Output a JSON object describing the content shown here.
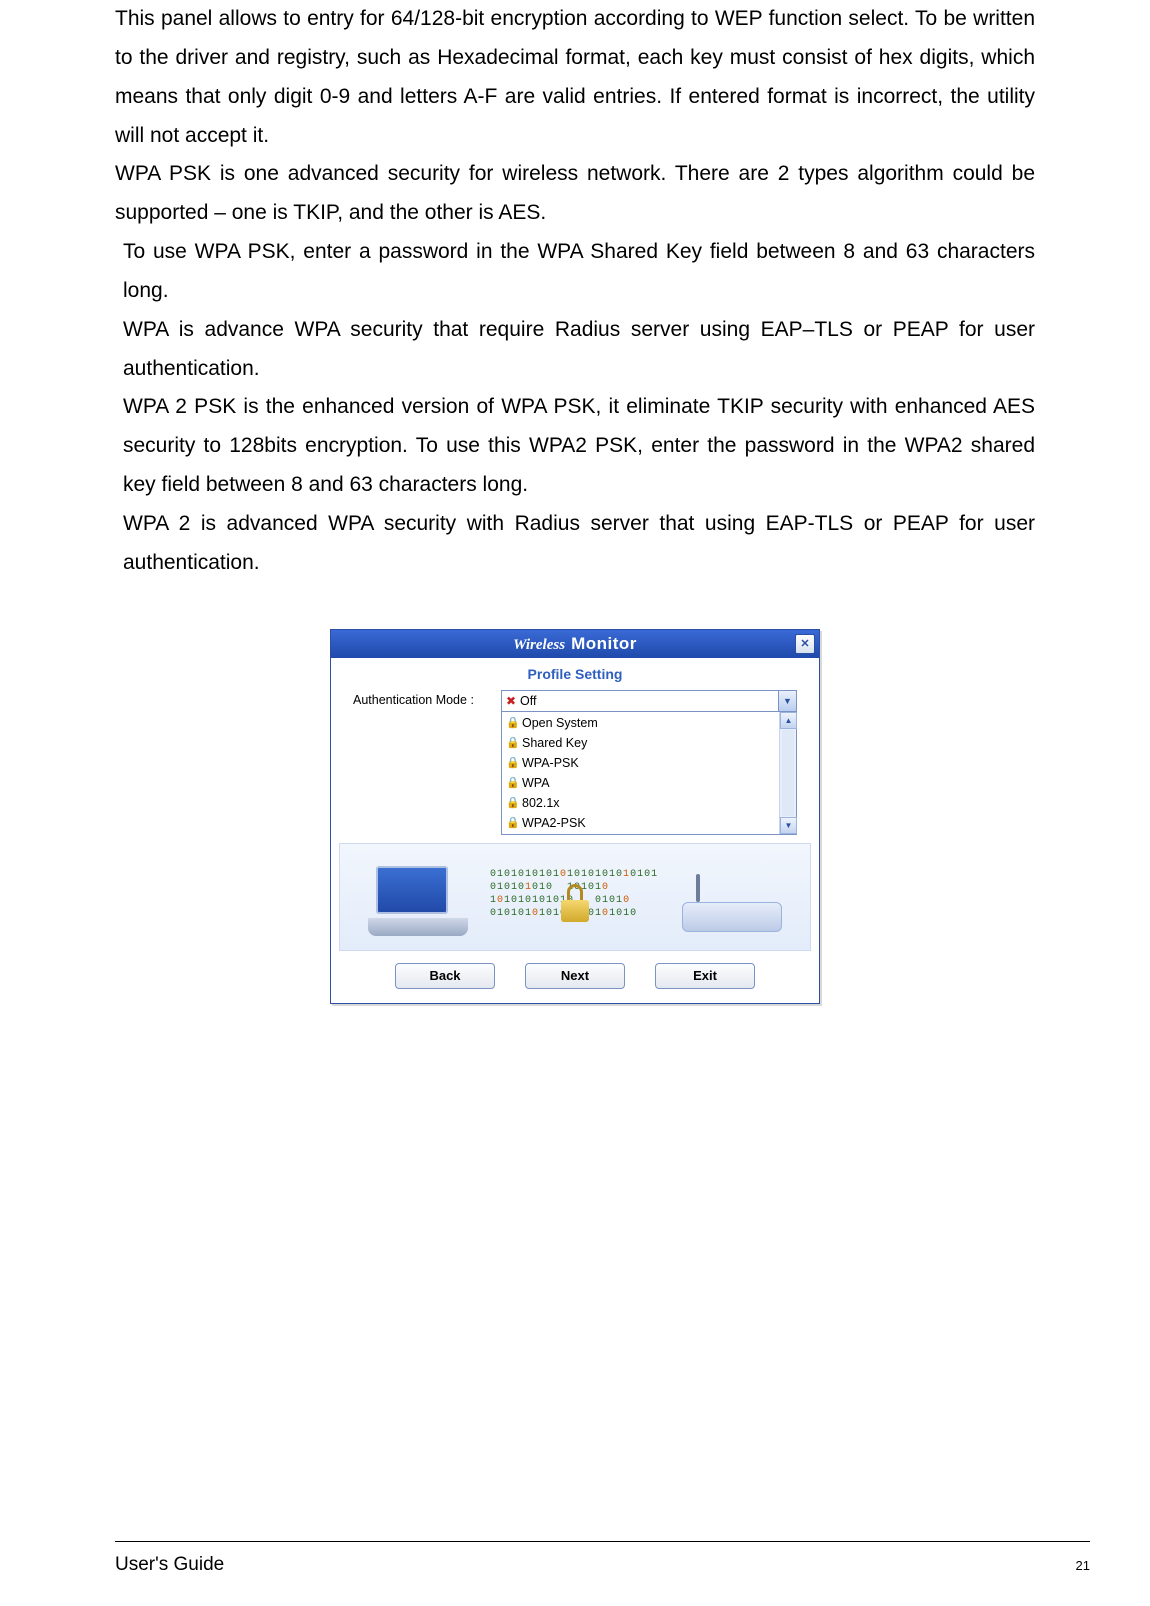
{
  "paragraphs": {
    "p1": "This panel allows to entry for 64/128-bit encryption according to WEP function select. To be written to the driver and registry, such as Hexadecimal format, each key must consist of hex digits, which means that only digit 0-9 and letters A-F are valid entries. If entered format is incorrect, the utility will not accept it.",
    "p2": "WPA PSK is one advanced security for wireless network. There are 2 types algorithm could be supported – one is TKIP, and the other is AES.",
    "p3": "To use WPA PSK, enter a password in the WPA Shared Key field between 8 and 63 characters long.",
    "p4": "WPA is advance WPA security that require Radius server using EAP–TLS or PEAP for user authentication.",
    "p5": "WPA 2 PSK is the enhanced version of WPA PSK, it eliminate TKIP security with enhanced AES security to 128bits encryption. To use this WPA2 PSK, enter the password in the WPA2 shared key field between 8 and 63 characters long.",
    "p6": "WPA 2 is advanced WPA security with Radius server that using EAP-TLS or PEAP for user authentication."
  },
  "monitor": {
    "title_wireless": "Wireless",
    "title_monitor": "Monitor",
    "close": "✕",
    "subtitle": "Profile Setting",
    "auth_label": "Authentication Mode :",
    "selected": {
      "icon": "✖",
      "text": "Off"
    },
    "options": [
      {
        "icon": "lock",
        "text": "Open System"
      },
      {
        "icon": "lock",
        "text": "Shared Key"
      },
      {
        "icon": "lock",
        "text": "WPA-PSK"
      },
      {
        "icon": "lock",
        "text": "WPA"
      },
      {
        "icon": "lock",
        "text": "802.1x"
      },
      {
        "icon": "lock",
        "text": "WPA2-PSK"
      }
    ],
    "buttons": {
      "back": "Back",
      "next": "Next",
      "exit": "Exit"
    }
  },
  "footer": {
    "left": "User's Guide",
    "page": "21"
  }
}
